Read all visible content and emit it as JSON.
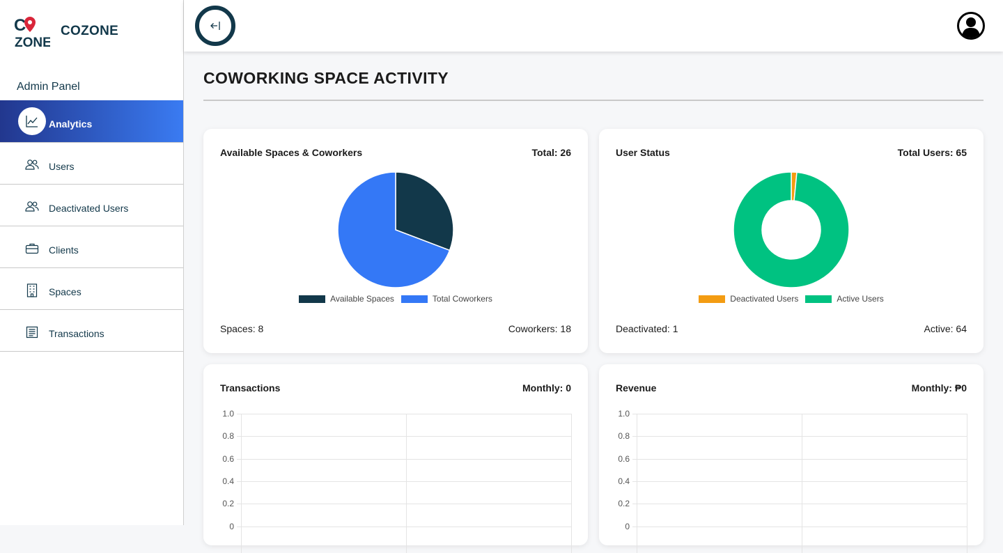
{
  "brand": {
    "name": "COZONE",
    "logo_text": "ZONE"
  },
  "sidebar": {
    "panel_title": "Admin Panel",
    "items": [
      {
        "label": "Analytics",
        "icon": "chart-line-icon",
        "active": true
      },
      {
        "label": "Users",
        "icon": "users-icon"
      },
      {
        "label": "Deactivated Users",
        "icon": "users-icon"
      },
      {
        "label": "Clients",
        "icon": "briefcase-icon"
      },
      {
        "label": "Spaces",
        "icon": "building-icon"
      },
      {
        "label": "Transactions",
        "icon": "receipt-icon"
      }
    ]
  },
  "header": {
    "collapse_icon": "collapse-left-icon",
    "avatar_icon": "user-circle-icon"
  },
  "page": {
    "title": "COWORKING SPACE ACTIVITY"
  },
  "cards": {
    "spaces": {
      "title": "Available Spaces & Coworkers",
      "total": "Total: 26",
      "legend": [
        "Available Spaces",
        "Total Coworkers"
      ],
      "footer_left": "Spaces: 8",
      "footer_right": "Coworkers: 18"
    },
    "users": {
      "title": "User Status",
      "total": "Total Users: 65",
      "legend": [
        "Deactivated Users",
        "Active Users"
      ],
      "footer_left": "Deactivated: 1",
      "footer_right": "Active: 64"
    },
    "transactions": {
      "title": "Transactions",
      "total": "Monthly: 0"
    },
    "revenue": {
      "title": "Revenue",
      "total": "Monthly: ₱0"
    }
  },
  "colors": {
    "navy": "#12384a",
    "blue": "#3478f6",
    "orange": "#f39c12",
    "green": "#00c281",
    "accent_start": "#22378e"
  },
  "chart_data": [
    {
      "type": "pie",
      "categories": [
        "Available Spaces",
        "Total Coworkers"
      ],
      "values": [
        8,
        18
      ],
      "colors": [
        "#12384a",
        "#3478f6"
      ]
    },
    {
      "type": "pie",
      "categories": [
        "Deactivated Users",
        "Active Users"
      ],
      "values": [
        1,
        64
      ],
      "colors": [
        "#f39c12",
        "#00c281"
      ],
      "donut": true
    },
    {
      "type": "line",
      "series": [],
      "yticks": [
        "1.0",
        "0.8",
        "0.6",
        "0.4",
        "0.2",
        "0"
      ],
      "ylim": [
        0,
        1
      ]
    },
    {
      "type": "line",
      "series": [],
      "yticks": [
        "1.0",
        "0.8",
        "0.6",
        "0.4",
        "0.2",
        "0"
      ],
      "ylim": [
        0,
        1
      ]
    }
  ]
}
